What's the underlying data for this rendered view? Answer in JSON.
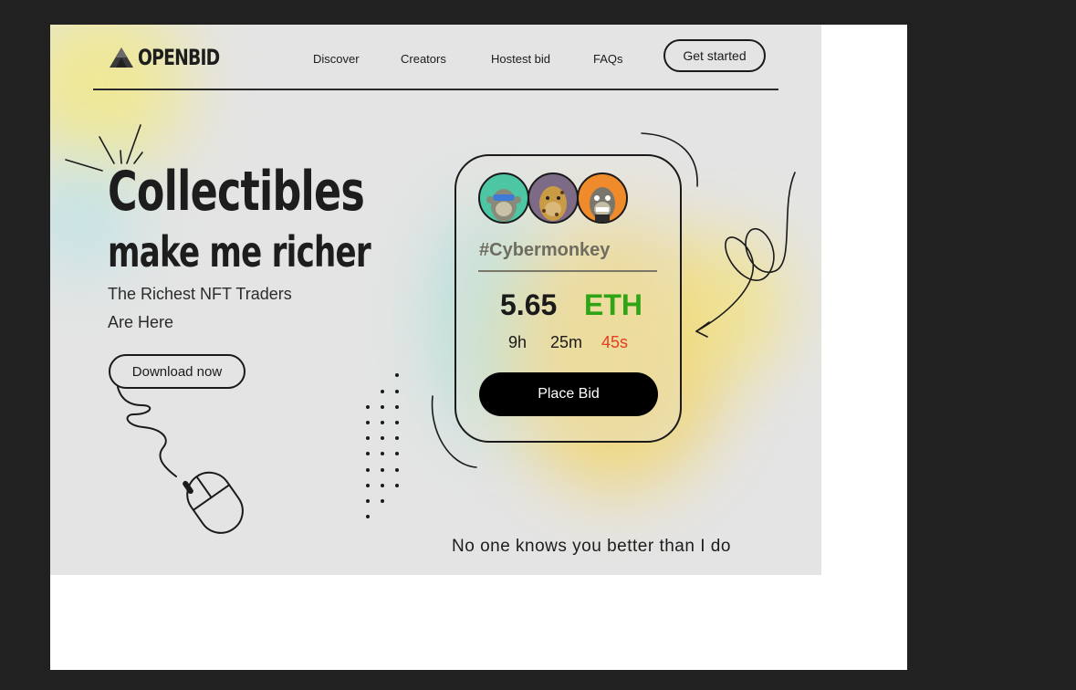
{
  "brand": {
    "name": "OPENBID",
    "logo_icon": "triangle-mountain-icon"
  },
  "nav": {
    "items": [
      "Discover",
      "Creators",
      "Hostest bid",
      "FAQs"
    ],
    "cta_label": "Get started"
  },
  "hero": {
    "title_line1": "Collectibles",
    "title_line2": "make me richer",
    "sub_line1": "The Richest NFT Traders",
    "sub_line2": "Are Here",
    "download_label": "Download now"
  },
  "bid_card": {
    "avatars": [
      "ape-avatar-teal-icon",
      "ape-avatar-purple-icon",
      "ape-avatar-orange-icon"
    ],
    "tag": "#Cybermonkey",
    "price": "5.65",
    "currency": "ETH",
    "timer": {
      "hours": "9h",
      "minutes": "25m",
      "seconds": "45s"
    },
    "bid_label": "Place Bid"
  },
  "tagline": "No one knows you better than I do",
  "colors": {
    "page_bg": "#212121",
    "hero_bg": "#e4e4e4",
    "accent_green": "#2fa516",
    "accent_red": "#e2401f",
    "button_black": "#000000"
  }
}
